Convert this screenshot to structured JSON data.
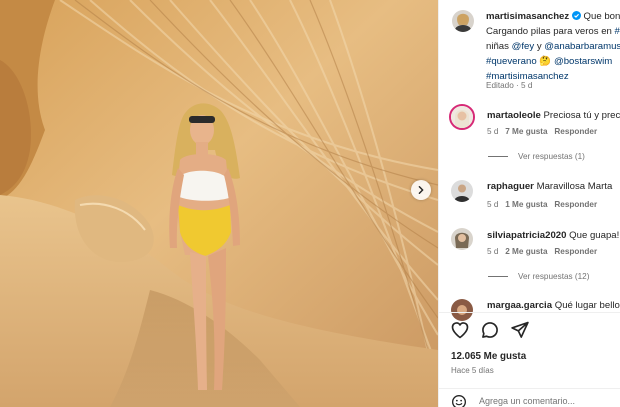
{
  "post": {
    "author": "martisimasanchez",
    "verified": true,
    "caption_line1": "Que bon",
    "caption_line2": "Cargando pilas para veros en",
    "caption_line2_tag": "#",
    "caption_line3_text": "niñas",
    "caption_mention_1": "@fey",
    "caption_and": "y",
    "caption_mention_2": "@anabarbaramus",
    "caption_hashtag_1": "#queverano",
    "caption_emoji": "🤔",
    "caption_mention_3": "@bostarswim",
    "caption_hashtag_2": "#martisimasanchez",
    "edited_label": "Editado · 5 d",
    "image_description_icon": "photo of woman in yellow swimsuit against sandstone rock"
  },
  "comments": [
    {
      "user": "martaoleole",
      "text": "Preciosa tú y prec",
      "age": "5 d",
      "likes": "7 Me gusta",
      "reply": "Responder",
      "view_replies": "Ver respuestas (1)"
    },
    {
      "user": "raphaguer",
      "text": "Maravillosa Marta",
      "age": "5 d",
      "likes": "1 Me gusta",
      "reply": "Responder"
    },
    {
      "user": "silviapatricia2020",
      "text": "Que guapa!",
      "age": "5 d",
      "likes": "2 Me gusta",
      "reply": "Responder",
      "view_replies": "Ver respuestas (12)"
    },
    {
      "user": "margaa.garcia",
      "text": "Qué lugar bello"
    }
  ],
  "footer": {
    "likes_count": "12.065 Me gusta",
    "posted_ago": "Hace 5 días",
    "add_comment_placeholder": "Agrega un comentario..."
  },
  "colors": {
    "link": "#00376b",
    "verified": "#0095f6",
    "muted": "#737373"
  }
}
